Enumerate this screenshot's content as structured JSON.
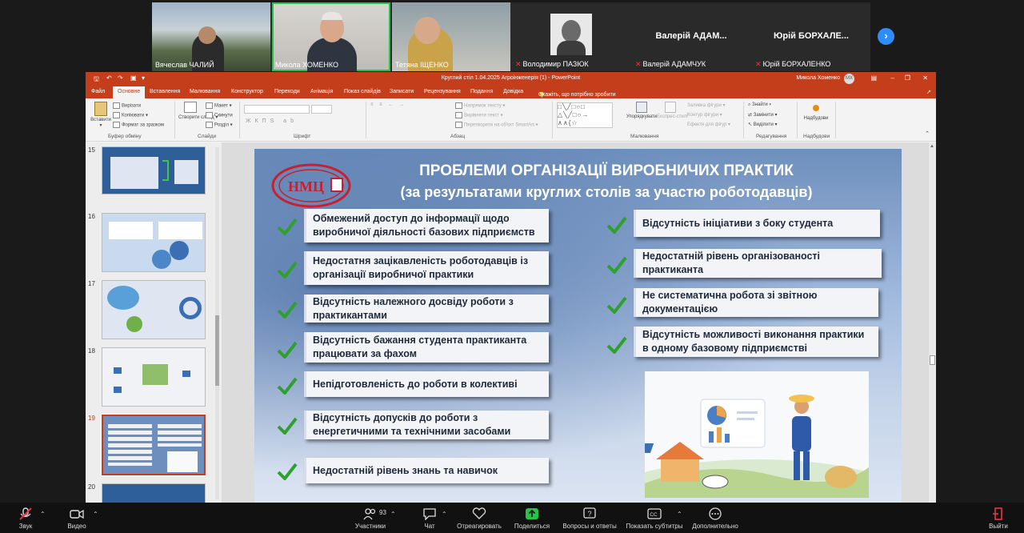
{
  "participants": [
    {
      "name": "Вячеслав ЧАЛИЙ",
      "muted": false
    },
    {
      "name": "Микола ХОМЕНКО",
      "muted": false
    },
    {
      "name": "Тетяна ІЩЕНКО",
      "muted": false
    },
    {
      "name": "Володимир ПАЗЮК",
      "muted": true
    },
    {
      "name": "Валерій АДАМЧУК",
      "muted": true,
      "display": "Валерій АДАМ..."
    },
    {
      "name": "Юрій БОРХАЛЕНКО",
      "muted": true,
      "display": "Юрій БОРХАЛЕ..."
    }
  ],
  "ppt": {
    "title": "Круглий стіл 1.04.2025 Агроінженерія (1)  -  PowerPoint",
    "user": "Микола Хоменко",
    "avatar": "МХ",
    "tabs": [
      "Файл",
      "Основне",
      "Вставлення",
      "Малювання",
      "Конструктор",
      "Переходи",
      "Анімація",
      "Показ слайдів",
      "Записати",
      "Рецензування",
      "Подання",
      "Довідка",
      "Скажіть, що потрібно зробити"
    ],
    "ribbon": {
      "paste": "Вставити",
      "cut": "Вирізати",
      "copy": "Копіювати",
      "format": "Формат за зразком",
      "clipboard": "Буфер обміну",
      "new_slide": "Створити слайд",
      "layout": "Макет",
      "reset": "Скинути",
      "section": "Розділ",
      "slides": "Слайди",
      "font": "Шрифт",
      "text_dir": "Напрямок тексту",
      "align_text": "Вирівняти текст",
      "smartart": "Перетворити на об'єкт SmartArt",
      "paragraph": "Абзац",
      "arrange": "Упорядкувати",
      "quick_styles": "Експрес-стилі",
      "shape_fill": "Заливка фігури",
      "shape_outline": "Контур фігури",
      "shape_effects": "Ефекти для фігур",
      "drawing": "Малювання",
      "find": "Знайти",
      "replace": "Замінити",
      "select": "Виділити",
      "editing": "Редагування",
      "addins": "Надбудови",
      "addins_group": "Надбудови"
    },
    "slide_numbers": [
      "15",
      "16",
      "17",
      "18",
      "19",
      "20"
    ],
    "slide": {
      "logo": "НМЦ",
      "title1": "ПРОБЛЕМИ ОРГАНІЗАЦІЇ ВИРОБНИЧИХ ПРАКТИК",
      "title2": "(за результатами круглих столів за участю роботодавців)",
      "left_items": [
        "Обмежений доступ до інформації щодо виробничої діяльності базових підприємств",
        "Недостатня зацікавленість роботодавців із організації виробничої практики",
        "Відсутність належного досвіду  роботи з практикантами",
        "Відсутність бажання студента практиканта працювати за фахом",
        "Непідготовленість до роботи в колективі",
        "Відсутність допусків до роботи з енергетичними та технічними засобами",
        "Недостатній рівень знань та навичок"
      ],
      "right_items": [
        "Відсутність ініціативи з боку студента",
        "Недостатній рівень організованості практиканта",
        "Не систематична робота зі звітною документацією",
        "Відсутність можливості виконання практики в одному базовому підприємстві"
      ]
    }
  },
  "toolbar": {
    "audio": "Звук",
    "video": "Видео",
    "participants": "Участники",
    "participants_count": "93",
    "chat": "Чат",
    "react": "Отреагировать",
    "share": "Поделиться",
    "qa": "Вопросы и ответы",
    "captions": "Показать субтитры",
    "more": "Дополнительно",
    "leave": "Выйти"
  },
  "colors": {
    "ppt_red": "#c43e1c",
    "active_speaker": "#26c24a",
    "zoom_blue": "#2d8cff",
    "check_green": "#2fa02f"
  }
}
